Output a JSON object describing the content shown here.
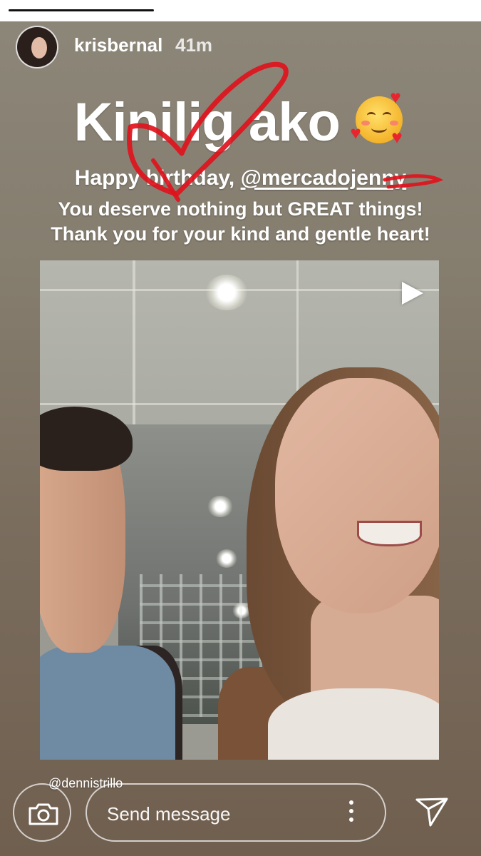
{
  "story": {
    "username": "krisbernal",
    "time_ago": "41m",
    "title": "Kinilig ako",
    "title_emoji": "smiling-face-with-hearts",
    "line1_prefix": "Happy birthday, ",
    "line1_mention": "@mercadojenny",
    "line2": "You deserve nothing but GREAT things!",
    "line3": "Thank you for your kind and gentle heart!",
    "media_tag": "@dennistrillo",
    "progress": 0.32
  },
  "footer": {
    "message_placeholder": "Send message"
  },
  "colors": {
    "scribble": "#e0121c",
    "text": "#ffffff",
    "progress": "#111111"
  }
}
